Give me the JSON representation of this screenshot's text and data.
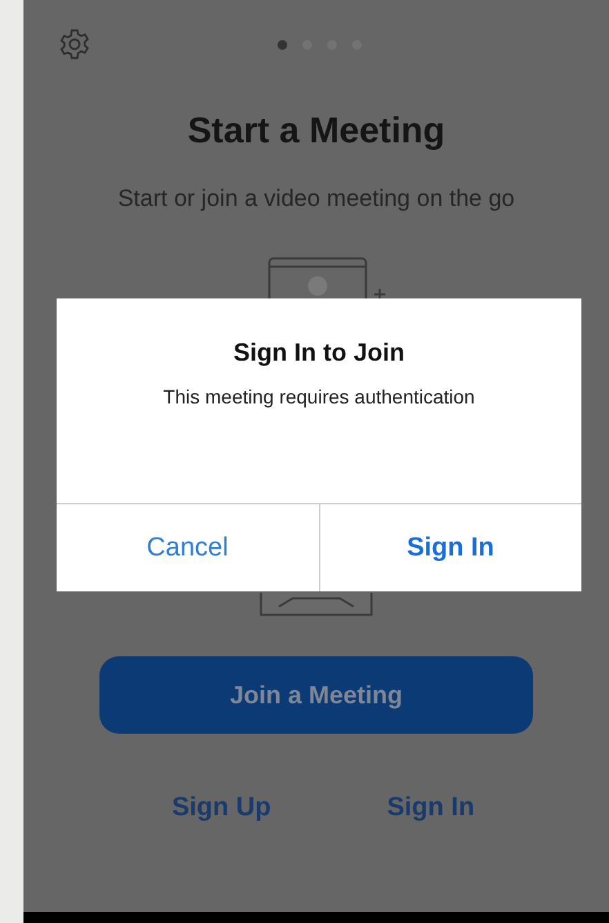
{
  "page_dots": [
    {
      "selected": true
    },
    {
      "selected": false
    },
    {
      "selected": false
    },
    {
      "selected": false
    }
  ],
  "title": "Start a Meeting",
  "subtitle": "Start or join a video meeting on the go",
  "join_button": "Join a Meeting",
  "links": [
    "Sign Up",
    "Sign In"
  ],
  "dialog": {
    "title": "Sign In to Join",
    "message": "This meeting requires authentication",
    "buttons": [
      {
        "label": "Cancel",
        "primary": false
      },
      {
        "label": "Sign In",
        "primary": true
      }
    ]
  }
}
